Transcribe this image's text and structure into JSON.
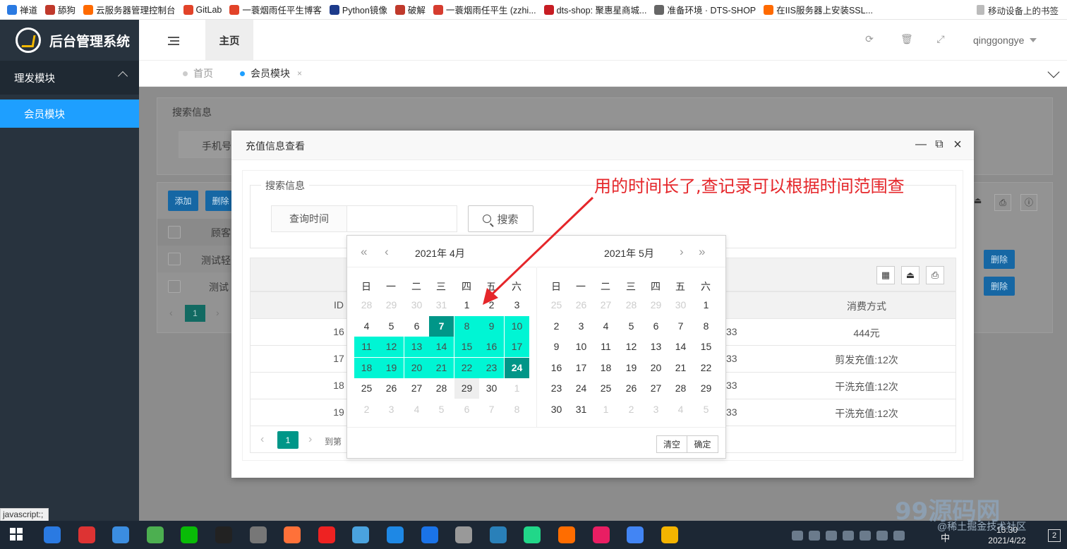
{
  "bookmarks": [
    {
      "label": "禅道",
      "color": "#2a7ae2"
    },
    {
      "label": "舔狗",
      "color": "#c0392b"
    },
    {
      "label": "云服务器管理控制台",
      "color": "#ff6a00"
    },
    {
      "label": "GitLab",
      "color": "#e24329"
    },
    {
      "label": "一蓑烟雨任平生博客",
      "color": "#e24329"
    },
    {
      "label": "Python镜像",
      "color": "#1d3b8b"
    },
    {
      "label": "破解",
      "color": "#c0392b"
    },
    {
      "label": "一蓑烟雨任平生 (zzhi...",
      "color": "#d63c2f"
    },
    {
      "label": "dts-shop: 聚惠星商城...",
      "color": "#c71d23"
    },
    {
      "label": "准备环境 · DTS-SHOP",
      "color": "#666666"
    },
    {
      "label": "在IIS服务器上安装SSL...",
      "color": "#ff6a00"
    }
  ],
  "bookmarks_right": "移动设备上的书签",
  "app": {
    "title": "后台管理系统"
  },
  "sidebar": {
    "group": "理发模块",
    "item": "会员模块"
  },
  "header": {
    "home_tab": "主页",
    "user": "qinggongye"
  },
  "tabs": [
    {
      "label": "首页"
    },
    {
      "label": "会员模块",
      "close": "×"
    }
  ],
  "bg": {
    "search_title": "搜索信息",
    "phone_label": "手机号",
    "add": "添加",
    "delete": "删除",
    "col_customer": "顾客",
    "rows": [
      "测试轻",
      "测试"
    ],
    "row_delete": "删除",
    "page": "1"
  },
  "dialog": {
    "title": "充值信息查看",
    "search_title": "搜索信息",
    "query_label": "查询时间",
    "query_value": "",
    "search_btn": "搜索",
    "columns": [
      "ID",
      "消费方式"
    ],
    "rows": [
      {
        "id": "16",
        "mid": "33",
        "pay": "444元"
      },
      {
        "id": "17",
        "mid": "33",
        "pay": "剪发充值:12次"
      },
      {
        "id": "18",
        "mid": "33",
        "pay": "干洗充值:12次"
      },
      {
        "id": "19",
        "mid": "33",
        "pay": "干洗充值:12次"
      }
    ],
    "page": "1",
    "goto": "到第"
  },
  "calendar": {
    "left_title": "2021年  4月",
    "right_title": "2021年  5月",
    "weekdays": [
      "日",
      "一",
      "二",
      "三",
      "四",
      "五",
      "六"
    ],
    "clear": "清空",
    "confirm": "确定",
    "range_start": "2021-04-07",
    "range_end": "2021-04-24",
    "today": "2021-04-29"
  },
  "annotation": "用的时间长了,查记录可以根据时间范围查",
  "status_text": "javascript:;",
  "taskbar": {
    "ime": "中",
    "time": "15:30",
    "date": "2021/4/22",
    "notif": "2"
  },
  "watermark": {
    "main": "99源码网",
    "sub": "@稀土掘金技术社区"
  },
  "colors": {
    "primary": "#1e9fff",
    "teal": "#009688",
    "range": "#00f5d4",
    "sidebar": "#28333e",
    "annotation": "#e5262a"
  }
}
